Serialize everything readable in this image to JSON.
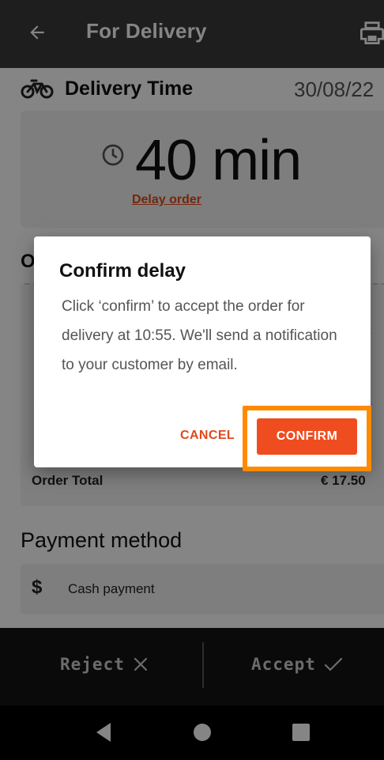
{
  "appbar": {
    "title": "For Delivery",
    "back_icon": "arrow-left-icon",
    "print_icon": "printer-icon"
  },
  "delivery": {
    "label": "Delivery Time",
    "date": "30/08/22",
    "minutes": "40 min",
    "delay_link": "Delay order"
  },
  "order": {
    "title_visible": "O",
    "total_label": "Order Total",
    "total_value": "€ 17.50"
  },
  "payment": {
    "title": "Payment method",
    "symbol": "$",
    "method": "Cash payment"
  },
  "actions": {
    "reject": "Reject",
    "accept": "Accept"
  },
  "dialog": {
    "title": "Confirm delay",
    "body": "Click ‘confirm’ to accept the order for delivery at 10:55. We'll send a notification to your customer by email.",
    "cancel": "CANCEL",
    "confirm": "CONFIRM"
  },
  "colors": {
    "accent": "#ef4d20",
    "highlight": "#ff8a00",
    "appbar": "#3b3b3b"
  }
}
